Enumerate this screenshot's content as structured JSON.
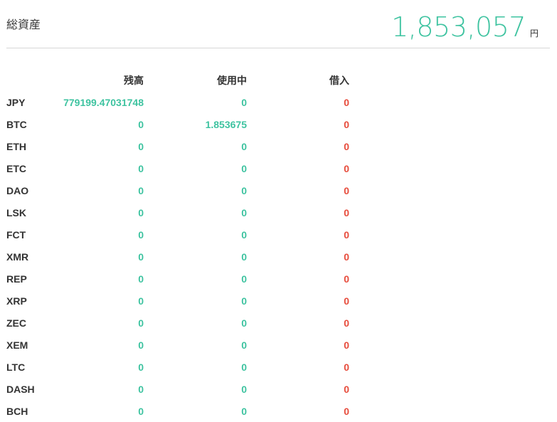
{
  "header": {
    "title": "総資産",
    "total": "1,853,057",
    "unit": "円"
  },
  "colors": {
    "positive": "#3ec3a0",
    "negative": "#e74c3c",
    "divider": "#d6d6d6"
  },
  "table": {
    "columns": {
      "balance": "残高",
      "in_use": "使用中",
      "borrowed": "借入"
    },
    "rows": [
      {
        "currency": "JPY",
        "balance": "779199.47031748",
        "in_use": "0",
        "borrowed": "0"
      },
      {
        "currency": "BTC",
        "balance": "0",
        "in_use": "1.853675",
        "borrowed": "0"
      },
      {
        "currency": "ETH",
        "balance": "0",
        "in_use": "0",
        "borrowed": "0"
      },
      {
        "currency": "ETC",
        "balance": "0",
        "in_use": "0",
        "borrowed": "0"
      },
      {
        "currency": "DAO",
        "balance": "0",
        "in_use": "0",
        "borrowed": "0"
      },
      {
        "currency": "LSK",
        "balance": "0",
        "in_use": "0",
        "borrowed": "0"
      },
      {
        "currency": "FCT",
        "balance": "0",
        "in_use": "0",
        "borrowed": "0"
      },
      {
        "currency": "XMR",
        "balance": "0",
        "in_use": "0",
        "borrowed": "0"
      },
      {
        "currency": "REP",
        "balance": "0",
        "in_use": "0",
        "borrowed": "0"
      },
      {
        "currency": "XRP",
        "balance": "0",
        "in_use": "0",
        "borrowed": "0"
      },
      {
        "currency": "ZEC",
        "balance": "0",
        "in_use": "0",
        "borrowed": "0"
      },
      {
        "currency": "XEM",
        "balance": "0",
        "in_use": "0",
        "borrowed": "0"
      },
      {
        "currency": "LTC",
        "balance": "0",
        "in_use": "0",
        "borrowed": "0"
      },
      {
        "currency": "DASH",
        "balance": "0",
        "in_use": "0",
        "borrowed": "0"
      },
      {
        "currency": "BCH",
        "balance": "0",
        "in_use": "0",
        "borrowed": "0"
      }
    ]
  }
}
